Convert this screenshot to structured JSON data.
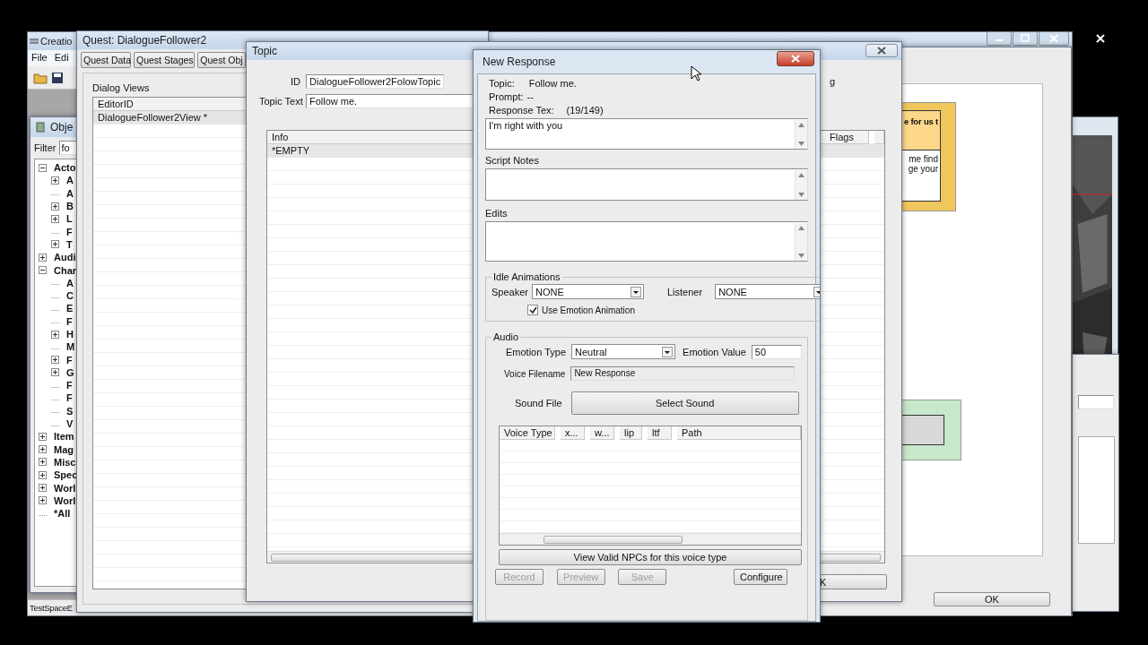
{
  "main_window": {
    "title": "Creatio",
    "menu": [
      "File",
      "Edi"
    ],
    "status_bar": "TestSpaceE"
  },
  "object_window": {
    "title": "Obje",
    "filter_label": "Filter",
    "filter_value": "fo",
    "tree": [
      {
        "label": "Acto",
        "kind": "expanded",
        "children": [
          {
            "label": "A",
            "kind": "collapsed"
          },
          {
            "label": "A",
            "kind": "leaf"
          },
          {
            "label": "B",
            "kind": "collapsed"
          },
          {
            "label": "L",
            "kind": "collapsed"
          },
          {
            "label": "F",
            "kind": "leaf"
          },
          {
            "label": "T",
            "kind": "collapsed"
          }
        ]
      },
      {
        "label": "Audi",
        "kind": "collapsed"
      },
      {
        "label": "Char",
        "kind": "expanded",
        "children": [
          {
            "label": "A",
            "kind": "leaf"
          },
          {
            "label": "C",
            "kind": "leaf"
          },
          {
            "label": "E",
            "kind": "leaf"
          },
          {
            "label": "F",
            "kind": "leaf"
          },
          {
            "label": "H",
            "kind": "collapsed"
          },
          {
            "label": "M",
            "kind": "leaf"
          },
          {
            "label": "F",
            "kind": "collapsed"
          },
          {
            "label": "G",
            "kind": "collapsed"
          },
          {
            "label": "F",
            "kind": "leaf"
          },
          {
            "label": "F",
            "kind": "leaf"
          },
          {
            "label": "S",
            "kind": "leaf"
          },
          {
            "label": "V",
            "kind": "leaf"
          }
        ]
      },
      {
        "label": "Item",
        "kind": "collapsed"
      },
      {
        "label": "Mag",
        "kind": "collapsed"
      },
      {
        "label": "Misc",
        "kind": "collapsed"
      },
      {
        "label": "Spec",
        "kind": "collapsed"
      },
      {
        "label": "Worl",
        "kind": "collapsed"
      },
      {
        "label": "Worl",
        "kind": "collapsed"
      },
      {
        "label": "*All",
        "kind": "leaf"
      }
    ]
  },
  "quest_window": {
    "title": "Quest: DialogueFollower2",
    "tabs": [
      {
        "label": "Quest Data",
        "selected": false
      },
      {
        "label": "Quest Stages",
        "selected": false
      },
      {
        "label": "Quest Obj",
        "selected": false
      }
    ],
    "dialog_views_label": "Dialog Views",
    "column": "EditorID",
    "rows": [
      "DialogueFollower2View *"
    ]
  },
  "dialogue_view_window": {
    "nodes": [
      {
        "kind": "topic",
        "header": "e for us t",
        "body": [
          "me find",
          "ge your"
        ]
      },
      {
        "kind": "response"
      }
    ],
    "ok_button": "OK"
  },
  "topic_window": {
    "title": "Topic",
    "id_label": "ID",
    "id_value": "DialogueFollower2FolowTopic",
    "topic_text_label": "Topic Text",
    "topic_text_value": "Follow me.",
    "info_column": "Info",
    "flags_column": "Flags",
    "rows": [
      "*EMPTY"
    ],
    "side_label": "g",
    "ok_button": "K"
  },
  "response_dialog": {
    "title": "New Response",
    "topic_label": "Topic:",
    "topic_value": "Follow me.",
    "prompt_label": "Prompt:",
    "prompt_value": "--",
    "response_label": "Response Tex:",
    "response_count": "(19/149)",
    "response_text": "I'm right with you",
    "script_notes_label": "Script Notes",
    "edits_label": "Edits",
    "idle_group": "Idle Animations",
    "speaker_label": "Speaker",
    "speaker_value": "NONE",
    "listener_label": "Listener",
    "listener_value": "NONE",
    "use_emotion": {
      "label": "Use Emotion Animation",
      "checked": true
    },
    "audio_group": "Audio",
    "emotion_type_label": "Emotion Type",
    "emotion_type_value": "Neutral",
    "emotion_value_label": "Emotion Value",
    "emotion_value": "50",
    "voice_filename_label": "Voice Filename",
    "voice_filename_value": "New Response",
    "sound_file_label": "Sound File",
    "select_sound_button": "Select Sound",
    "voice_columns": [
      "Voice Type",
      "x...",
      "w...",
      "lip",
      "ltf",
      "Path"
    ],
    "view_npcs_button": "View Valid NPCs for this voice type",
    "buttons": [
      {
        "label": "Record",
        "disabled": true
      },
      {
        "label": "Preview",
        "disabled": true
      },
      {
        "label": "Save",
        "disabled": true
      },
      {
        "label": "Configure",
        "disabled": false
      }
    ]
  }
}
